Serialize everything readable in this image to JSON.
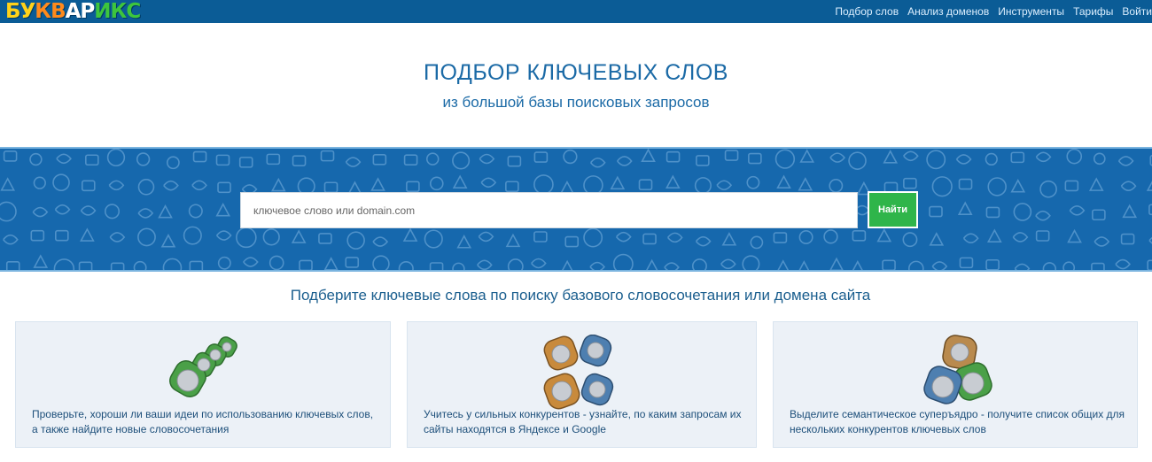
{
  "logo": {
    "text": "БУКВАРИКС",
    "letters": [
      "Б",
      "У",
      "К",
      "В",
      "А",
      "Р",
      "И",
      "К",
      "С"
    ],
    "colors": [
      "#ffd21a",
      "#ffd21a",
      "#ff8a1c",
      "#ff8a1c",
      "#ffffff",
      "#ffffff",
      "#3dc53d",
      "#3dc53d",
      "#3dc53d"
    ]
  },
  "nav": {
    "items": [
      "Подбор слов",
      "Анализ доменов",
      "Инструменты",
      "Тарифы",
      "Войти"
    ]
  },
  "hero": {
    "title": "ПОДБОР КЛЮЧЕВЫХ СЛОВ",
    "subtitle": "из большой базы поисковых запросов"
  },
  "search": {
    "placeholder": "ключевое слово или domain.com",
    "button_label": "Найти"
  },
  "section": {
    "title": "Подберите ключевые слова по поиску базового словосочетания или домена сайта"
  },
  "cards": [
    {
      "text": "Проверьте, хороши ли ваши идеи по использованию ключевых слов, а также найдите новые словосочетания",
      "icon": "green-key-tags-icon"
    },
    {
      "text": "Учитесь у сильных конкурентов - узнайте, по каким запросам их сайты находятся в Яндексе и Google",
      "icon": "brown-blue-key-tags-icon"
    },
    {
      "text": "Выделите семантическое суперъядро - получите список общих для нескольких конкурентов ключевых слов",
      "icon": "overlapping-key-tags-icon"
    }
  ],
  "colors": {
    "nav_bg": "#0b5c96",
    "band_bg": "#1668ad",
    "button": "#2fb54a",
    "card_bg": "#ecf1f7"
  }
}
